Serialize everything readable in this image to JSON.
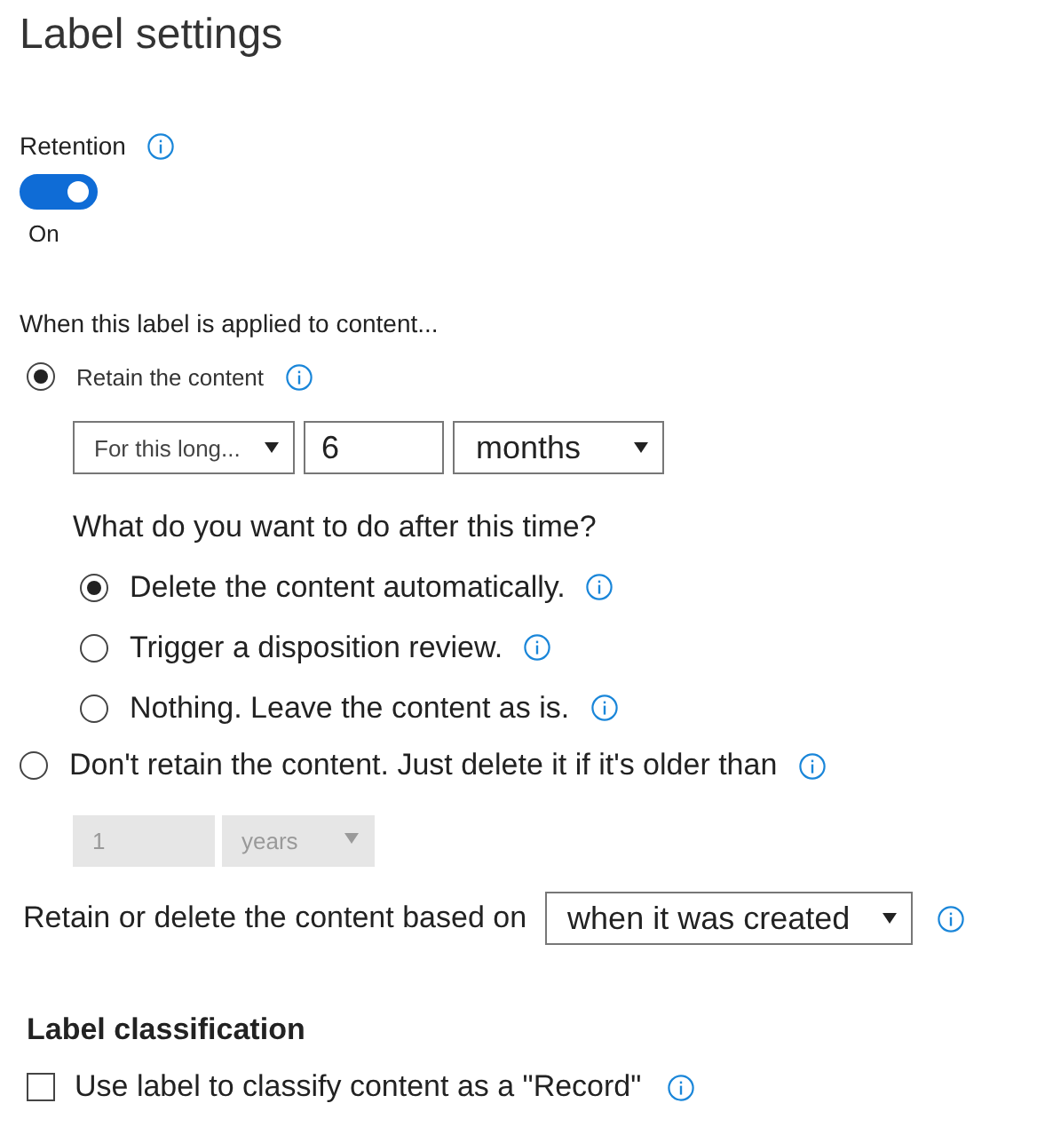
{
  "title": "Label settings",
  "retention": {
    "label": "Retention",
    "on": true,
    "state_text": "On"
  },
  "applied_heading": "When this label is applied to content...",
  "retain_option": {
    "label": "Retain the content",
    "selected": true
  },
  "period": {
    "mode": "For this long...",
    "value": "6",
    "unit": "months"
  },
  "after_question": "What do you want to do after this time?",
  "after_options": [
    {
      "label": "Delete the content automatically.",
      "selected": true
    },
    {
      "label": "Trigger a disposition review.",
      "selected": false
    },
    {
      "label": "Nothing. Leave the content as is.",
      "selected": false
    }
  ],
  "delete_option": {
    "label": "Don't retain the content. Just delete it if it's older than",
    "selected": false
  },
  "delete_period": {
    "value": "1",
    "unit": "years",
    "disabled": true
  },
  "based_on": {
    "label": "Retain or delete the content based on",
    "value": "when it was created"
  },
  "classification": {
    "heading": "Label classification",
    "record": {
      "label": "Use label to classify content as a \"Record\"",
      "checked": false
    }
  }
}
